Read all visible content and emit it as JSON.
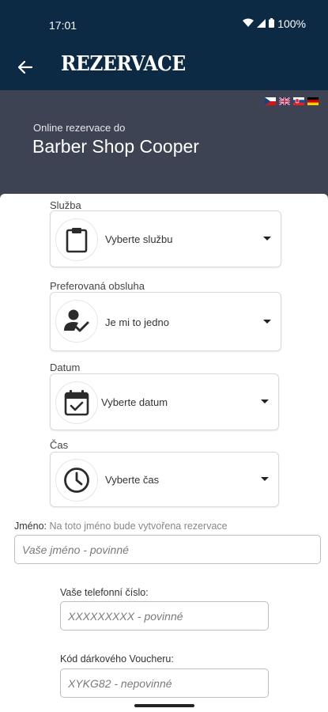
{
  "status": {
    "time": "17:01",
    "battery": "100%"
  },
  "appbar": {
    "title": "REZERVACE"
  },
  "header": {
    "subtitle": "Online rezervace do",
    "title": "Barber Shop Cooper",
    "languages": [
      "cz",
      "gb",
      "sk",
      "de"
    ]
  },
  "form": {
    "service": {
      "label": "Služba",
      "value": "Vyberte službu",
      "icon": "clipboard-icon"
    },
    "staff": {
      "label": "Preferovaná obsluha",
      "value": "Je mi to jedno",
      "icon": "person-check-icon"
    },
    "date": {
      "label": "Datum",
      "value": "Vyberte datum",
      "icon": "calendar-check-icon"
    },
    "time": {
      "label": "Čas",
      "value": "Vyberte čas",
      "icon": "clock-icon"
    },
    "name": {
      "label": "Jméno:",
      "hint": "Na toto jméno bude vytvořena rezervace",
      "placeholder": "Vaše jméno - povinné"
    },
    "phone": {
      "label": "Vaše telefonní číslo:",
      "placeholder": "XXXXXXXXX - povinné"
    },
    "voucher": {
      "label": "Kód dárkového Voucheru:",
      "placeholder": "XYKG82 - nepovinné"
    }
  }
}
